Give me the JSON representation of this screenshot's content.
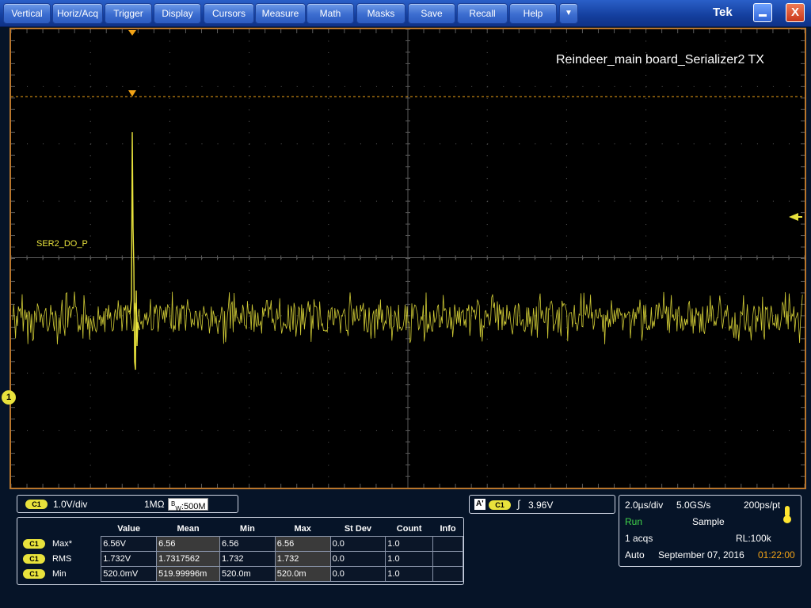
{
  "menu": {
    "buttons": [
      "Vertical",
      "Horiz/Acq",
      "Trigger",
      "Display",
      "Cursors",
      "Measure",
      "Math",
      "Masks",
      "Save",
      "Recall",
      "Help"
    ],
    "dropdown_glyph": "▼",
    "brand": "Tek",
    "close_glyph": "X"
  },
  "graticule": {
    "annotation": "Reindeer_main board_Serializer2 TX",
    "channel_label": "SER2_DO_P",
    "channel_number": "1",
    "trace_color": "#e8e23c",
    "grid_color": "#5a5a5a",
    "trigger_color": "#f2a316"
  },
  "vertical": {
    "channel_badge": "C1",
    "scale": "1.0V/div",
    "impedance": "1MΩ",
    "bw_prefix": "B",
    "bw_sub": "W",
    "bandwidth": ":500M"
  },
  "measurements": {
    "headers": [
      "",
      "",
      "Value",
      "Mean",
      "Min",
      "Max",
      "St Dev",
      "Count",
      "Info"
    ],
    "rows": [
      {
        "badge": "C1",
        "name": "Max*",
        "value": "6.56V",
        "mean": "6.56",
        "min": "6.56",
        "max": "6.56",
        "stdev": "0.0",
        "count": "1.0",
        "info": ""
      },
      {
        "badge": "C1",
        "name": "RMS",
        "value": "1.732V",
        "mean": "1.7317562",
        "min": "1.732",
        "max": "1.732",
        "stdev": "0.0",
        "count": "1.0",
        "info": ""
      },
      {
        "badge": "C1",
        "name": "Min",
        "value": "520.0mV",
        "mean": "519.99996m",
        "min": "520.0m",
        "max": "520.0m",
        "stdev": "0.0",
        "count": "1.0",
        "info": ""
      }
    ]
  },
  "trigger": {
    "mode_badge": "A'",
    "channel_badge": "C1",
    "slope_glyph": "∫",
    "level": "3.96V"
  },
  "acquisition": {
    "timebase": "2.0µs/div",
    "sample_rate": "5.0GS/s",
    "resolution": "200ps/pt",
    "state": "Run",
    "mode": "Sample",
    "acqs": "1 acqs",
    "record_length": "RL:100k",
    "trigger_mode": "Auto",
    "date": "September 07, 2016",
    "time": "01:22:00"
  }
}
